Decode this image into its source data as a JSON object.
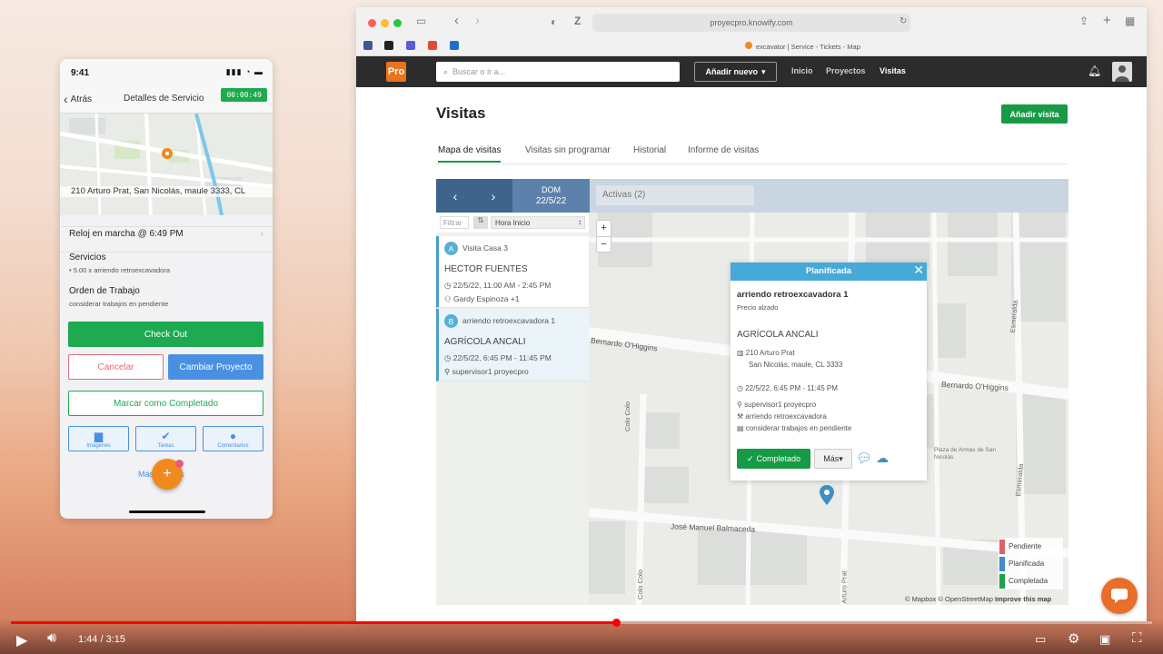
{
  "phone": {
    "status_time": "9:41",
    "nav": {
      "back_label": "Atrás",
      "title": "Detalles de Servicio",
      "timer": "00:00:49"
    },
    "address": "210 Arturo Prat, San Nicolás, maule 3333, CL",
    "clock_label": "Reloj en marcha @ 6:49 PM",
    "services_title": "Servicios",
    "services_item": "• 5.00 x arriendo retroexcavadora",
    "work_order_title": "Orden de Trabajo",
    "work_order_desc": "considerar trabajos en pendiente",
    "checkout_label": "Check Out",
    "cancel_label": "Cancelar",
    "change_project_label": "Cambiar Proyecto",
    "mark_complete_label": "Marcar como Completado",
    "tiles": [
      {
        "label": "Imágenes",
        "icon": "folder-icon"
      },
      {
        "label": "Tareas",
        "icon": "check-circle-icon"
      },
      {
        "label": "Comentarios",
        "icon": "chat-icon"
      }
    ],
    "more_label": "Más detalles",
    "fab_label": "+"
  },
  "browser": {
    "url": "proyecpro.knowify.com",
    "tab_title": "excavator | Service - Tickets - Map",
    "app": {
      "logo": "Pro",
      "search_placeholder": "Buscar o ir a...",
      "add_new_label": "Añadir nuevo",
      "nav": [
        "Inicio",
        "Proyectos",
        "Visitas"
      ]
    },
    "page_title": "Visitas",
    "add_visit_label": "Añadir visita",
    "tabs": [
      "Mapa de visitas",
      "Visitas sin programar",
      "Historial",
      "Informe de visitas"
    ],
    "calendar": {
      "day": "DOM",
      "date": "22/5/22",
      "active_filter": "Activas (2)"
    },
    "filter": {
      "placeholder": "Filtrar",
      "sort_label": "Hora Inicio"
    },
    "visits": [
      {
        "badge": "A",
        "title": "Visita Casa 3",
        "client": "HECTOR FUENTES",
        "time": "22/5/22, 11:00 AM - 2:45 PM",
        "assignee": "Gardy Espinoza +1"
      },
      {
        "badge": "B",
        "title": "arriendo retroexcavadora 1",
        "client": "AGRÍCOLA ANCALI",
        "time": "22/5/22, 6:45 PM - 11:45 PM",
        "assignee": "supervisor1 proyecpro"
      }
    ],
    "map": {
      "zoom_in": "+",
      "zoom_out": "−",
      "streets": [
        "Bernardo O'Higgins",
        "Bernardo O'Higgins",
        "José Manuel Balmaceda",
        "Esmeralda",
        "Esmeralda",
        "Colo Colo",
        "Colo Colo",
        "Arturo Prat",
        "Plaza de Armas de San Nicolás"
      ],
      "popup": {
        "status": "Planificada",
        "title": "arriendo retroexcavadora 1",
        "price_type": "Precio alzado",
        "client": "AGRÍCOLA ANCALI",
        "address_line1": "210 Arturo Prat",
        "address_line2": "San Nicolás, maule, CL 3333",
        "time": "22/5/22, 6:45 PM - 11:45 PM",
        "assignee": "supervisor1 proyecpro",
        "service": "arriendo retroexcavadora",
        "notes": "considerar trabajos en pendiente",
        "complete_label": "Completado",
        "more_label": "Más"
      },
      "legend": [
        {
          "label": "Pendiente",
          "color": "#e0606a"
        },
        {
          "label": "Planificada",
          "color": "#3d8fc4"
        },
        {
          "label": "Completada",
          "color": "#1fa34a"
        }
      ],
      "attribution": "© Mapbox © OpenStreetMap",
      "improve_label": "Improve this map"
    }
  },
  "video": {
    "time": "1:44 / 3:15",
    "progress": 0.53
  }
}
